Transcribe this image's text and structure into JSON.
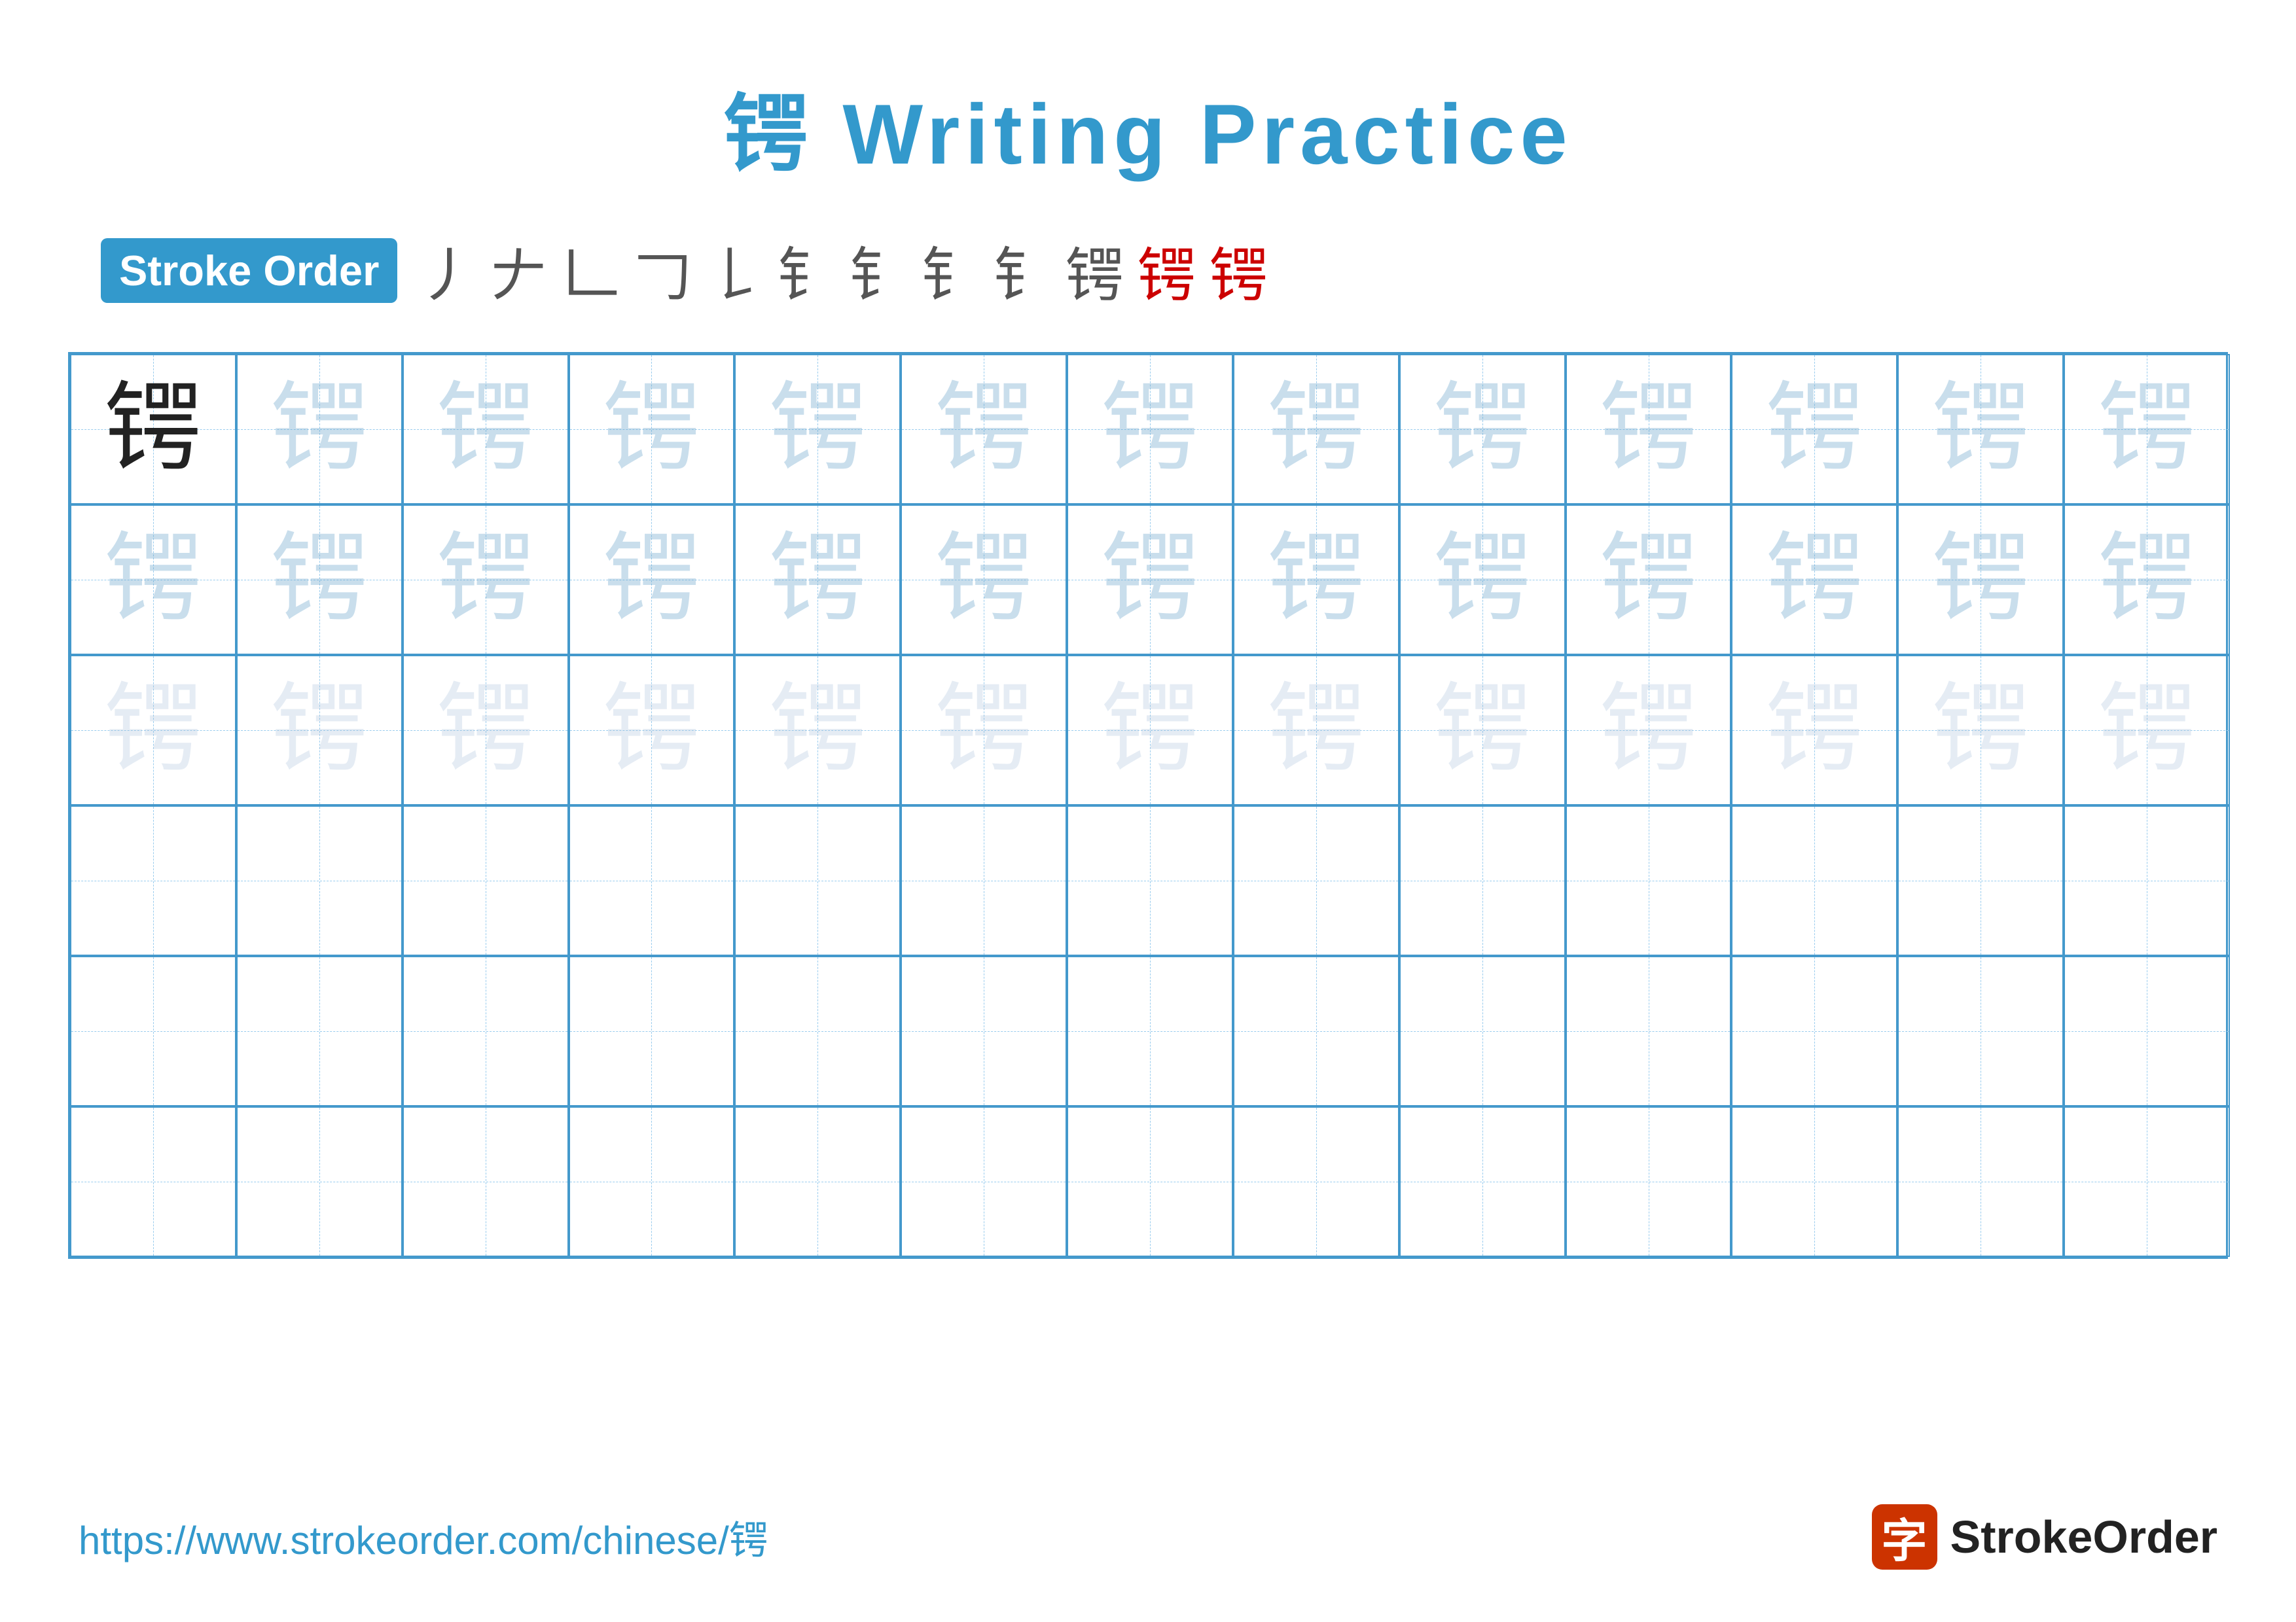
{
  "title": "锷 Writing Practice",
  "stroke_order_badge": "Stroke Order",
  "stroke_steps": [
    "㇐",
    "㇒",
    "𠃊",
    "𠃌",
    "𠄌",
    "𠄢",
    "𠄣",
    "𠄤",
    "𠄥",
    "锷",
    "锷",
    "锷"
  ],
  "character": "锷",
  "rows": [
    {
      "type": "practice",
      "cells": [
        "dark",
        "light1",
        "light1",
        "light1",
        "light1",
        "light1",
        "light1",
        "light1",
        "light1",
        "light1",
        "light1",
        "light1",
        "light1"
      ]
    },
    {
      "type": "practice",
      "cells": [
        "light1",
        "light1",
        "light1",
        "light1",
        "light1",
        "light1",
        "light1",
        "light1",
        "light1",
        "light1",
        "light1",
        "light1",
        "light1"
      ]
    },
    {
      "type": "practice",
      "cells": [
        "light2",
        "light2",
        "light2",
        "light2",
        "light2",
        "light2",
        "light2",
        "light2",
        "light2",
        "light2",
        "light2",
        "light2",
        "light2"
      ]
    },
    {
      "type": "empty"
    },
    {
      "type": "empty"
    },
    {
      "type": "empty"
    }
  ],
  "footer": {
    "url": "https://www.strokeorder.com/chinese/锷",
    "logo_char": "字",
    "logo_text": "StrokeOrder"
  }
}
